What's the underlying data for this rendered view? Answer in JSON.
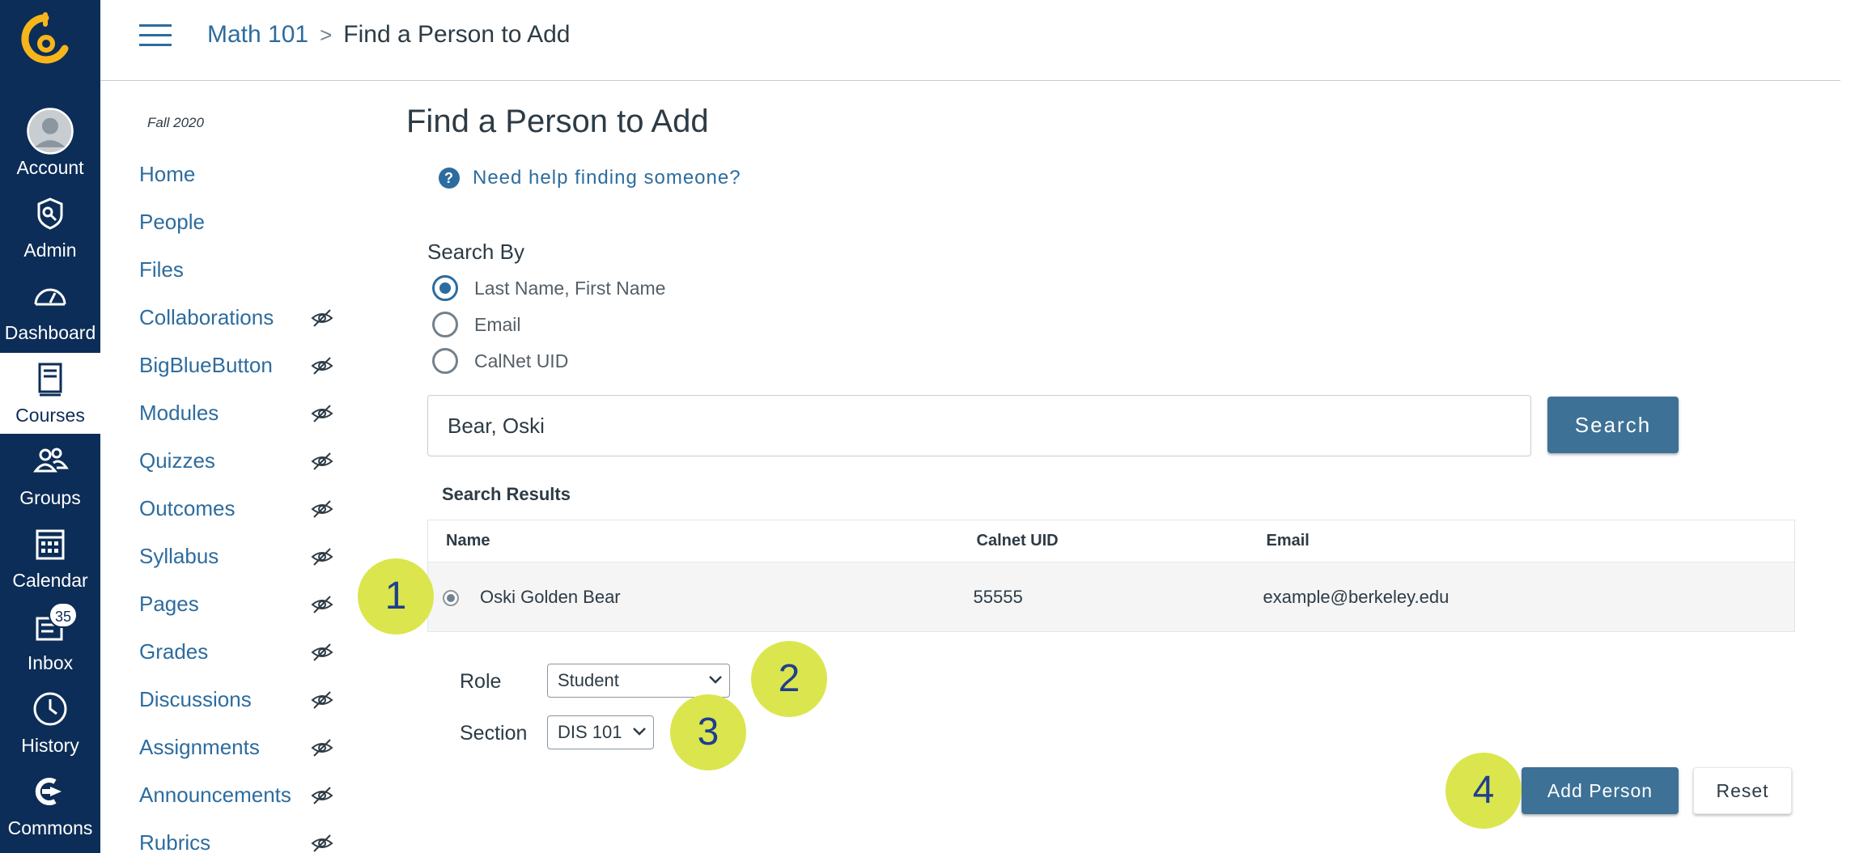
{
  "global_nav": {
    "items": [
      {
        "label": "Account",
        "icon": "account-avatar-icon"
      },
      {
        "label": "Admin",
        "icon": "admin-shield-icon"
      },
      {
        "label": "Dashboard",
        "icon": "dashboard-gauge-icon"
      },
      {
        "label": "Courses",
        "icon": "courses-book-icon",
        "active": true
      },
      {
        "label": "Groups",
        "icon": "groups-people-icon"
      },
      {
        "label": "Calendar",
        "icon": "calendar-icon"
      },
      {
        "label": "Inbox",
        "icon": "inbox-icon",
        "badge": "35"
      },
      {
        "label": "History",
        "icon": "history-clock-icon"
      },
      {
        "label": "Commons",
        "icon": "commons-arrow-icon"
      }
    ]
  },
  "header": {
    "breadcrumb": {
      "course": "Math 101",
      "separator": ">",
      "current": "Find a Person to Add"
    }
  },
  "course_nav": {
    "term": "Fall 2020",
    "items": [
      {
        "label": "Home",
        "hidden": false
      },
      {
        "label": "People",
        "hidden": false
      },
      {
        "label": "Files",
        "hidden": false
      },
      {
        "label": "Collaborations",
        "hidden": true
      },
      {
        "label": "BigBlueButton",
        "hidden": true
      },
      {
        "label": "Modules",
        "hidden": true
      },
      {
        "label": "Quizzes",
        "hidden": true
      },
      {
        "label": "Outcomes",
        "hidden": true
      },
      {
        "label": "Syllabus",
        "hidden": true
      },
      {
        "label": "Pages",
        "hidden": true
      },
      {
        "label": "Grades",
        "hidden": true
      },
      {
        "label": "Discussions",
        "hidden": true
      },
      {
        "label": "Assignments",
        "hidden": true
      },
      {
        "label": "Announcements",
        "hidden": true
      },
      {
        "label": "Rubrics",
        "hidden": true
      }
    ]
  },
  "main": {
    "title": "Find a Person to Add",
    "help_icon": "?",
    "help_link": "Need help finding someone?",
    "search_by": {
      "label": "Search By",
      "options": [
        {
          "label": "Last Name, First Name",
          "checked": true
        },
        {
          "label": "Email",
          "checked": false
        },
        {
          "label": "CalNet UID",
          "checked": false
        }
      ]
    },
    "search": {
      "value": "Bear, Oski",
      "button_label": "Search"
    },
    "results": {
      "label": "Search Results",
      "columns": [
        "Name",
        "Calnet UID",
        "Email"
      ],
      "rows": [
        {
          "name": "Oski Golden Bear",
          "uid": "55555",
          "email": "example@berkeley.edu",
          "selected": true
        }
      ]
    },
    "role": {
      "label": "Role",
      "value": "Student"
    },
    "section": {
      "label": "Section",
      "value": "DIS 101"
    },
    "add_button": "Add Person",
    "reset_button": "Reset",
    "step_markers": [
      "1",
      "2",
      "3",
      "4"
    ]
  },
  "colors": {
    "global_nav_bg": "#0c2d57",
    "link": "#2d6c9e",
    "primary_button": "#3d7196",
    "marker_bg": "#dbe64e",
    "marker_text": "#1f3f8f",
    "logo": "#f7b51c"
  }
}
